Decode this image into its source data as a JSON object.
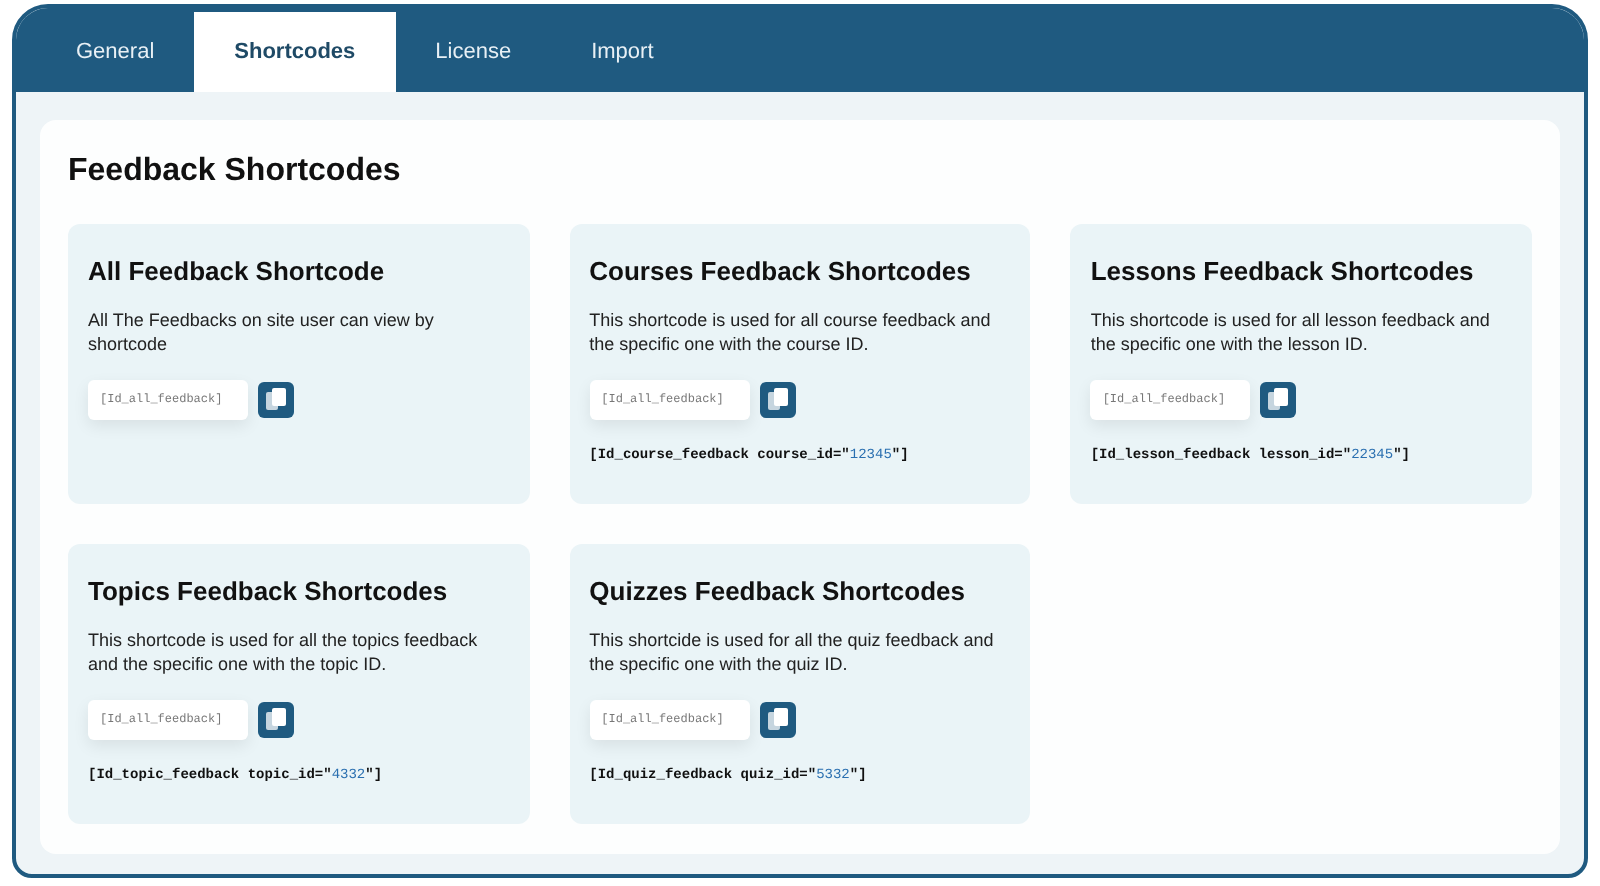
{
  "tabs": [
    {
      "label": "General",
      "selected": false
    },
    {
      "label": "Shortcodes",
      "selected": true
    },
    {
      "label": "License",
      "selected": false
    },
    {
      "label": "Import",
      "selected": false
    }
  ],
  "panel": {
    "title": "Feedback Shortcodes"
  },
  "cards": [
    {
      "title": "All Feedback Shortcode",
      "description": "All The Feedbacks on site user can view by shortcode",
      "field_value": "[Id_all_feedback]"
    },
    {
      "title": "Courses Feedback Shortcodes",
      "description": "This shortcode is used for all course feedback and the specific one with the course ID.",
      "field_value": "[Id_all_feedback]",
      "code": {
        "before": "[Id_course_feedback course_id=\"",
        "value": "12345",
        "after": "\"]"
      }
    },
    {
      "title": "Lessons Feedback Shortcodes",
      "description": "This shortcode is used for all lesson feedback and the specific one with the lesson ID.",
      "field_value": "[Id_all_feedback]",
      "code": {
        "before": "[Id_lesson_feedback lesson_id=\"",
        "value": "22345",
        "after": "\"]"
      }
    },
    {
      "title": "Topics Feedback Shortcodes",
      "description": "This shortcode is used for all the topics feedback and the specific one with the topic ID.",
      "field_value": "[Id_all_feedback]",
      "code": {
        "before": "[Id_topic_feedback topic_id=\"",
        "value": "4332",
        "after": "\"]"
      }
    },
    {
      "title": "Quizzes Feedback Shortcodes",
      "description": "This shortcide is used for all the quiz feedback and the specific one with the quiz ID.",
      "field_value": "[Id_all_feedback]",
      "code": {
        "before": "[Id_quiz_feedback quiz_id=\"",
        "value": "5332",
        "after": "\"]"
      }
    }
  ]
}
